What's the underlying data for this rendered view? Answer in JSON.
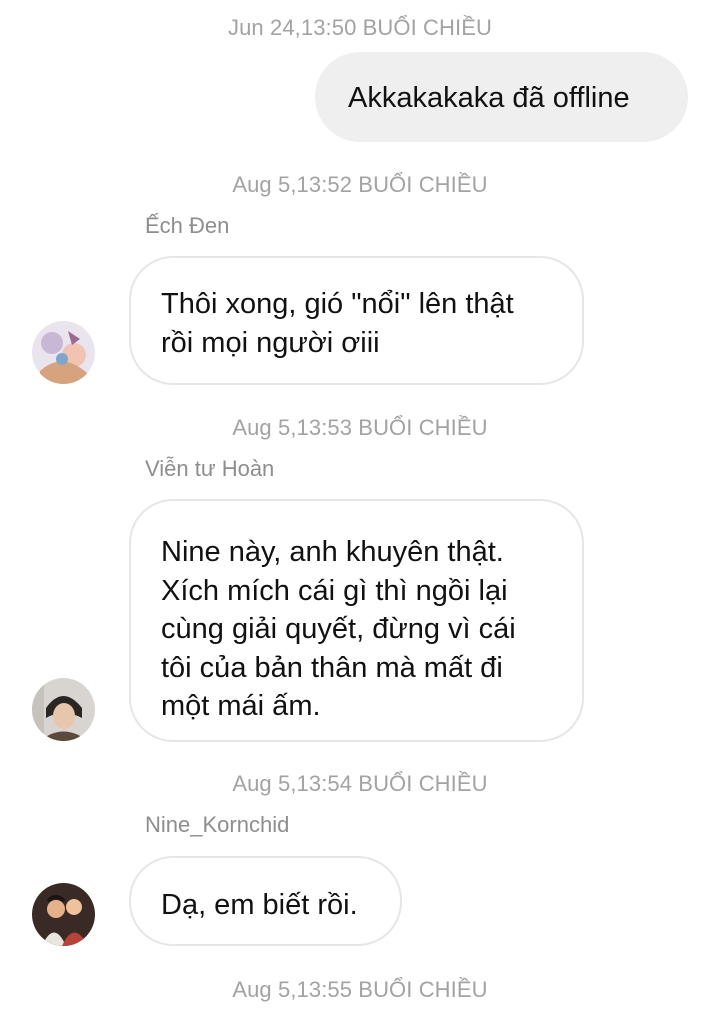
{
  "messages": [
    {
      "timestamp": "Jun 24,13:50 BUỔI CHIỀU",
      "direction": "outgoing",
      "text": "Akkakakaka đã offline"
    },
    {
      "timestamp": "Aug 5,13:52 BUỔI CHIỀU",
      "direction": "incoming",
      "sender": "Ếch Đen",
      "avatar_icon": "user-avatar-icon",
      "text": "Thôi xong, gió \"nổi\" lên thật\nrồi mọi người ơiii"
    },
    {
      "timestamp": "Aug 5,13:53 BUỔI CHIỀU",
      "direction": "incoming",
      "sender": "Viễn tư Hoàn",
      "avatar_icon": "user-avatar-icon",
      "text": "Nine này, anh khuyên thật.\nXích mích cái gì thì ngồi lại\ncùng giải quyết, đừng vì cái\ntôi của bản thân mà mất đi\nmột mái ấm."
    },
    {
      "timestamp": "Aug 5,13:54 BUỔI CHIỀU",
      "direction": "incoming",
      "sender": "Nine_Kornchid",
      "avatar_icon": "user-avatar-icon",
      "text": "Dạ, em biết rồi."
    },
    {
      "timestamp": "Aug 5,13:55 BUỔI CHIỀU"
    }
  ],
  "colors": {
    "background": "#ffffff",
    "timestamp_text": "#a3a3a3",
    "sender_text": "#8e8e8e",
    "outgoing_bubble": "#efefef",
    "incoming_bubble_border": "#e6e6e6",
    "message_text": "#111111"
  }
}
